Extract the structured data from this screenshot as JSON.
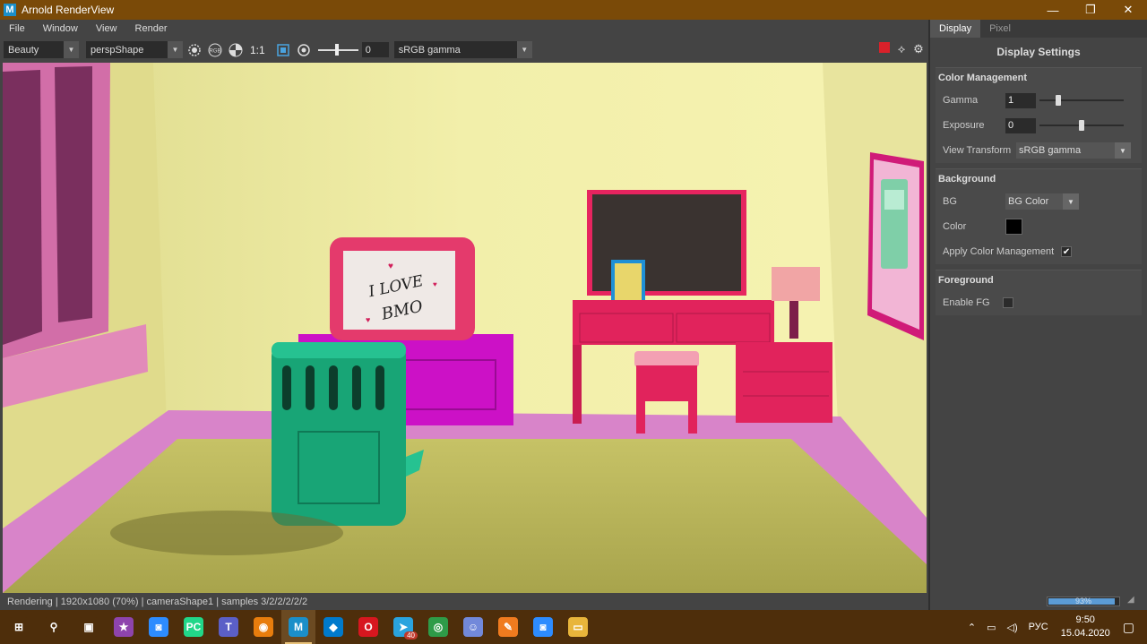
{
  "window": {
    "title": "Arnold RenderView",
    "controls": [
      "—",
      "❐",
      "✕"
    ]
  },
  "menu": [
    "File",
    "Window",
    "View",
    "Render"
  ],
  "toolbar": {
    "aov": "Beauty",
    "camera": "perspShape",
    "rgb_label": "RGB",
    "ratio_label": "1:1",
    "exposure_value": "0",
    "view_transform": "sRGB gamma"
  },
  "status": {
    "text": "Rendering | 1920x1080 (70%) | cameraShape1 | samples 3/2/2/2/2/2",
    "progress_text": "93%",
    "progress_value": 0.93
  },
  "panel": {
    "tabs": [
      {
        "label": "Display",
        "active": true
      },
      {
        "label": "Pixel",
        "active": false
      }
    ],
    "header": "Display Settings",
    "color_management": {
      "title": "Color Management",
      "gamma_label": "Gamma",
      "gamma_value": "1",
      "gamma_slider": 0.2,
      "exposure_label": "Exposure",
      "exposure_value": "0",
      "exposure_slider": 0.5,
      "view_transform_label": "View Transform",
      "view_transform_value": "sRGB gamma"
    },
    "background": {
      "title": "Background",
      "bg_label": "BG",
      "bg_value": "BG Color",
      "color_label": "Color",
      "color_value": "#000000",
      "apply_label": "Apply Color Management",
      "apply_checked": true
    },
    "foreground": {
      "title": "Foreground",
      "enable_label": "Enable FG",
      "enable_checked": false
    }
  },
  "render_text": {
    "sign_line1": "I LOVE",
    "sign_line2": "BMO"
  },
  "taskbar": {
    "apps": [
      {
        "name": "start",
        "glyph": "⊞",
        "color": "#4e2e0b"
      },
      {
        "name": "search",
        "glyph": "⚲",
        "color": "#4e2e0b"
      },
      {
        "name": "task-view",
        "glyph": "▣",
        "color": "#4e2e0b"
      },
      {
        "name": "app-star",
        "glyph": "★",
        "color": "#8e44ad"
      },
      {
        "name": "zoom-meeting",
        "glyph": "◙",
        "color": "#2d8cff"
      },
      {
        "name": "pycharm",
        "glyph": "PC",
        "color": "#21d789"
      },
      {
        "name": "teams",
        "glyph": "T",
        "color": "#5b5fc7"
      },
      {
        "name": "blender",
        "glyph": "◉",
        "color": "#e87d0d"
      },
      {
        "name": "maya",
        "glyph": "M",
        "color": "#1b8fc9"
      },
      {
        "name": "vscode",
        "glyph": "◆",
        "color": "#007acc"
      },
      {
        "name": "opera",
        "glyph": "O",
        "color": "#d7171f"
      },
      {
        "name": "telegram",
        "glyph": "➤",
        "color": "#2aa3de"
      },
      {
        "name": "chrome",
        "glyph": "◎",
        "color": "#2e9b48"
      },
      {
        "name": "discord",
        "glyph": "☺",
        "color": "#7289da"
      },
      {
        "name": "app-orange",
        "glyph": "✎",
        "color": "#f07b1f"
      },
      {
        "name": "zoom",
        "glyph": "◙",
        "color": "#2d8cff"
      },
      {
        "name": "file-explorer",
        "glyph": "▭",
        "color": "#e8b53b"
      }
    ],
    "telegram_badge": "40",
    "tray": {
      "chevron": "⌃",
      "lang": "РУС",
      "time": "9:50",
      "date": "15.04.2020"
    }
  }
}
